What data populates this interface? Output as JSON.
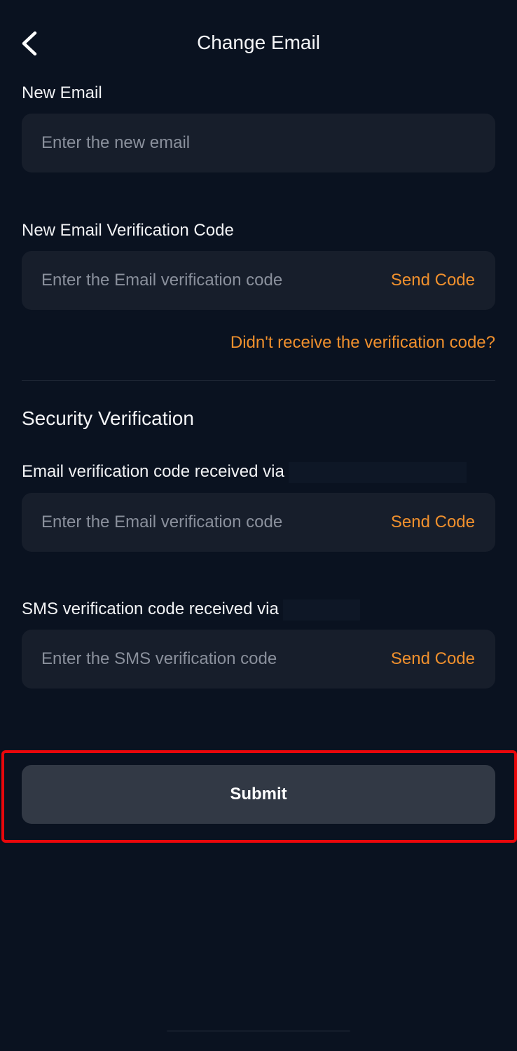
{
  "header": {
    "title": "Change Email",
    "back_icon": "chevron-left-icon"
  },
  "new_email": {
    "label": "New Email",
    "placeholder": "Enter the new email",
    "value": ""
  },
  "new_email_code": {
    "label": "New Email Verification Code",
    "placeholder": "Enter the Email verification code",
    "value": "",
    "send_label": "Send Code"
  },
  "help_link": "Didn't receive the verification code?",
  "security": {
    "title": "Security Verification",
    "email_code": {
      "label": "Email verification code received via",
      "placeholder": "Enter the Email verification code",
      "value": "",
      "send_label": "Send Code"
    },
    "sms_code": {
      "label": "SMS verification code received via",
      "placeholder": "Enter the SMS verification code",
      "value": "",
      "send_label": "Send Code"
    }
  },
  "submit_label": "Submit",
  "colors": {
    "background": "#0a1220",
    "field": "#171e2b",
    "accent": "#f0902d",
    "button": "#323945",
    "highlight": "#e8070b"
  }
}
